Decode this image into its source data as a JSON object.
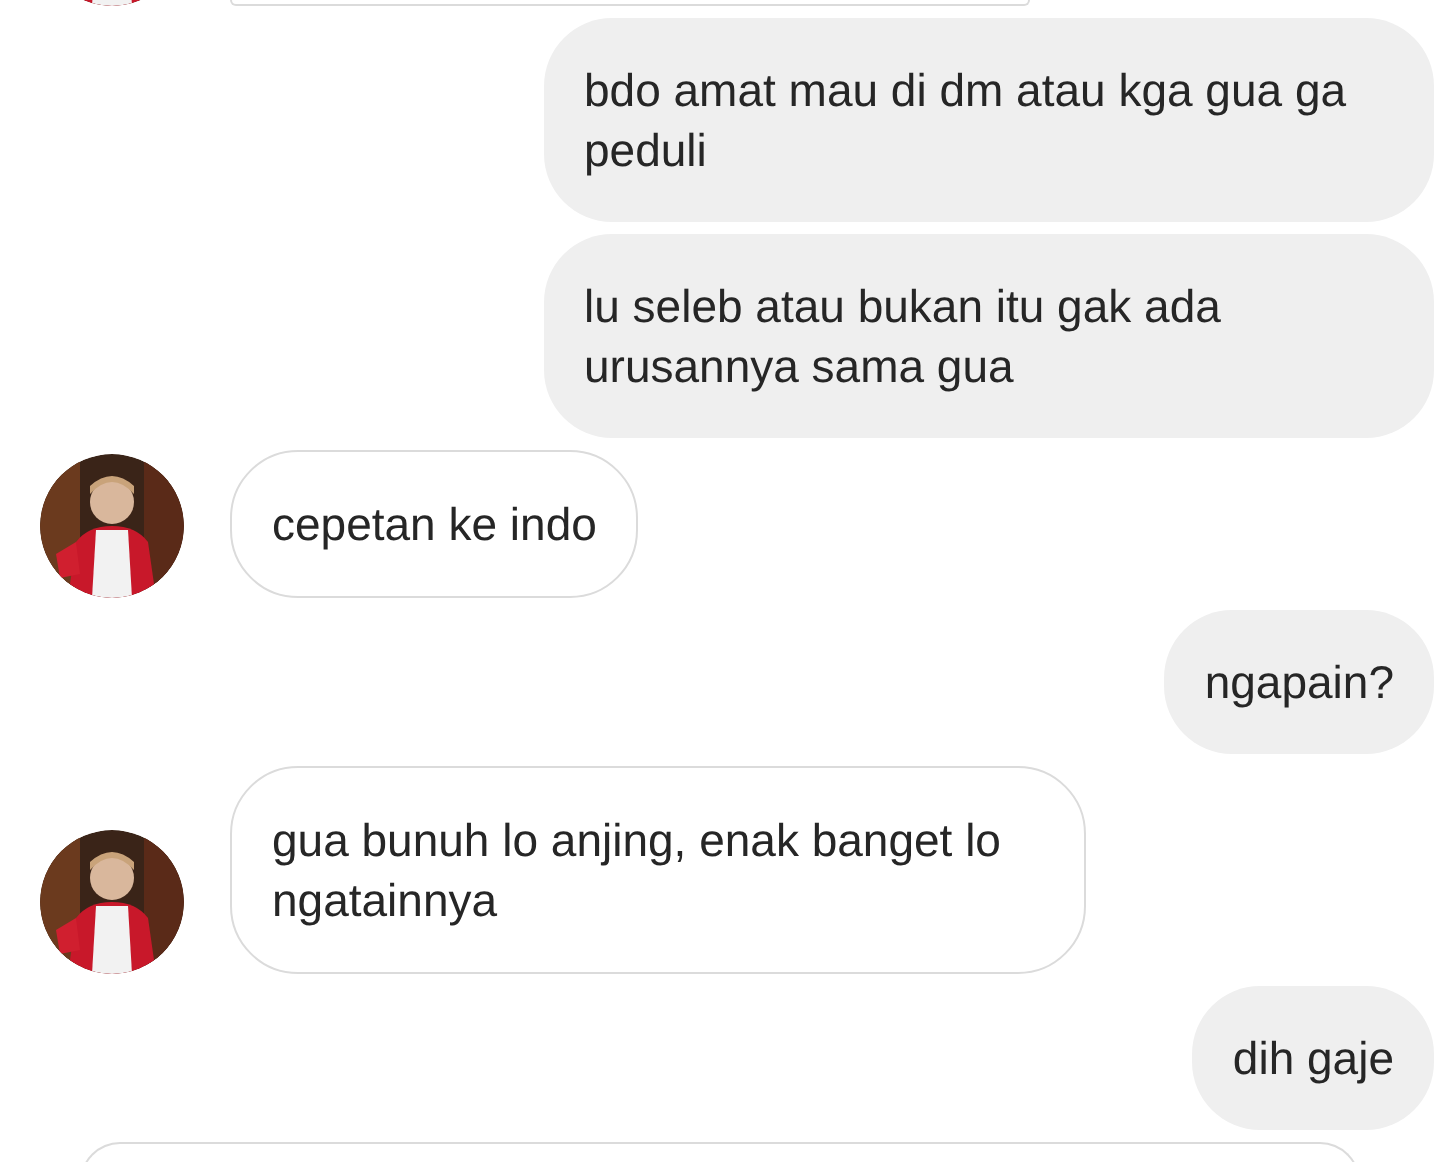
{
  "cut_off_top": {
    "kind": "received"
  },
  "messages": [
    {
      "kind": "sent",
      "text": "bdo amat mau di dm atau kga gua ga peduli"
    },
    {
      "kind": "sent",
      "text": "lu seleb atau bukan itu gak ada urusannya sama gua"
    },
    {
      "kind": "received",
      "text": "cepetan ke indo"
    },
    {
      "kind": "sent",
      "text": "ngapain?"
    },
    {
      "kind": "received",
      "text": "gua bunuh lo anjing, enak banget lo ngatainnya"
    },
    {
      "kind": "sent",
      "text": "dih gaje"
    }
  ],
  "cut_off_bottom": {
    "kind": "received"
  }
}
